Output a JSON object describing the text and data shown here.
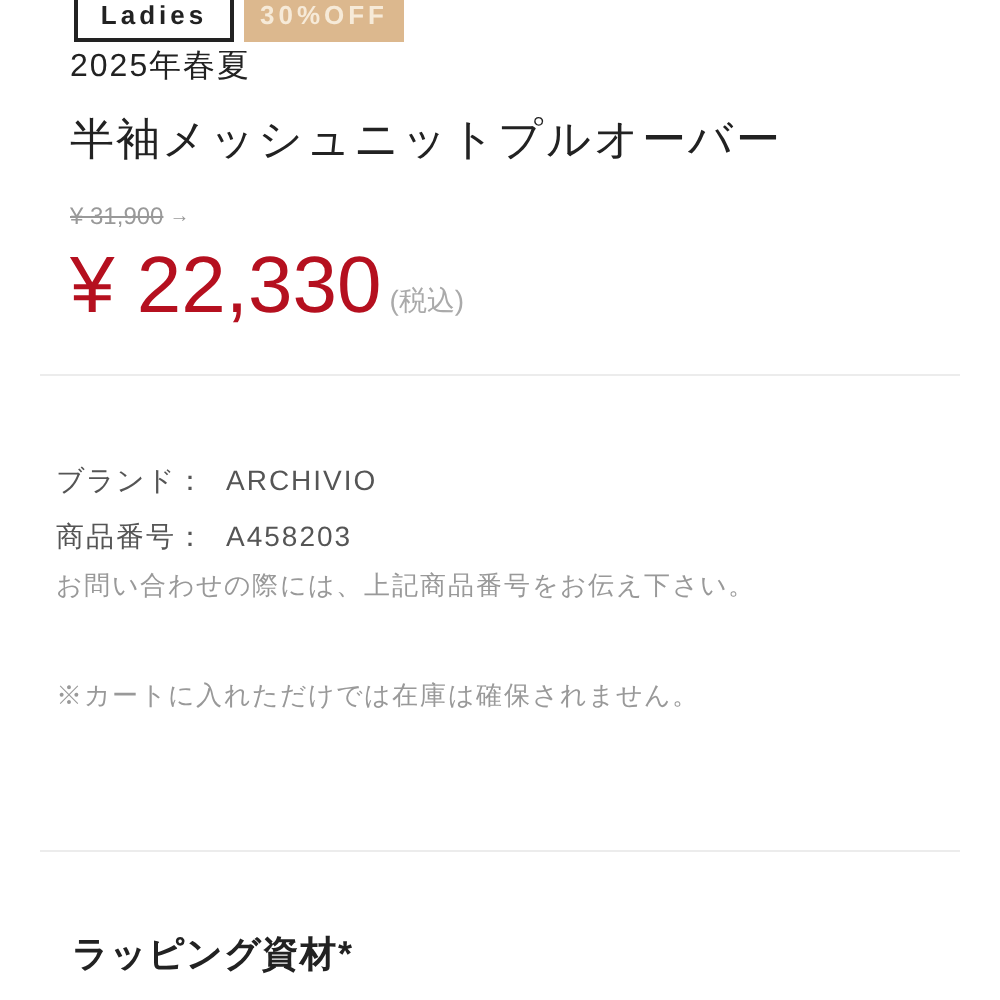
{
  "tags": [
    {
      "label": "Ladies",
      "kind": "outline"
    },
    {
      "label": "30%OFF",
      "kind": "sale"
    }
  ],
  "season": "2025年春夏",
  "product_name": "半袖メッシュニットプルオーバー",
  "old_price": "¥ 31,900",
  "old_price_arrow": "→",
  "price": "¥ 22,330",
  "tax_note": "(税込)",
  "details": [
    {
      "label": "ブランド：",
      "value": "ARCHIVIO"
    },
    {
      "label": "商品番号：",
      "value": "A458203"
    }
  ],
  "inquiry_note": "お問い合わせの際には、上記商品番号をお伝え下さい。",
  "stock_note": "※カートに入れただけでは在庫は確保されません。",
  "wrapping_heading": "ラッピング資材*"
}
